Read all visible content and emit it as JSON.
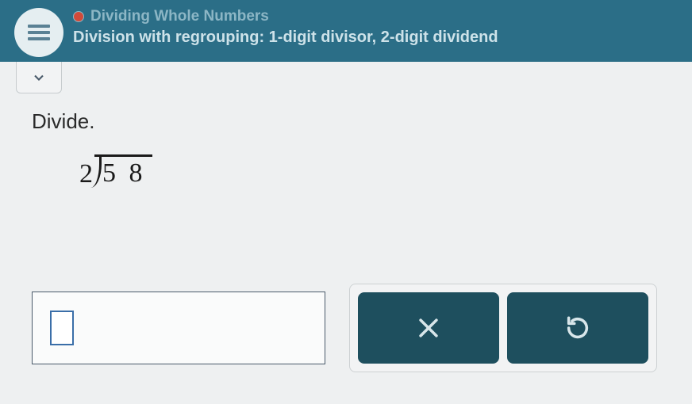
{
  "header": {
    "topic": "Dividing Whole Numbers",
    "subtitle": "Division with regrouping: 1-digit divisor, 2-digit dividend"
  },
  "problem": {
    "instruction": "Divide.",
    "divisor": "2",
    "dividend": "5 8"
  },
  "icons": {
    "close": "x",
    "undo": "↺"
  }
}
